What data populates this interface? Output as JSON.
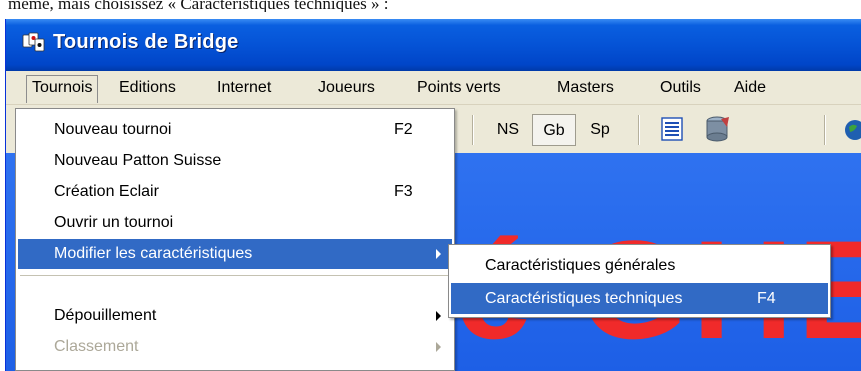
{
  "document": {
    "intro_text": "même, mais choisissez « Caractéristiques techniques » :"
  },
  "window": {
    "title": "Tournois de Bridge",
    "title_icon": "bridge-app-icon",
    "titlebar_color": "#0553d6"
  },
  "menubar": {
    "items": [
      {
        "label": "Tournois",
        "active": true
      },
      {
        "label": "Editions"
      },
      {
        "label": "Internet"
      },
      {
        "label": "Joueurs"
      },
      {
        "label": "Points verts"
      },
      {
        "label": "Masters"
      },
      {
        "label": "Outils"
      },
      {
        "label": "Aide"
      }
    ]
  },
  "toolbar": {
    "buttons": [
      {
        "label": "NS"
      },
      {
        "label": "Gb",
        "pressed": true
      },
      {
        "label": "Sp"
      }
    ],
    "icons": [
      "list-icon",
      "database-icon",
      "globe-icon"
    ]
  },
  "dropdown": {
    "items": [
      {
        "label": "Nouveau tournoi",
        "shortcut": "F2"
      },
      {
        "label": "Nouveau Patton Suisse",
        "shortcut": ""
      },
      {
        "label": "Création Eclair",
        "shortcut": "F3"
      },
      {
        "label": "Ouvrir un tournoi",
        "shortcut": ""
      },
      {
        "label": "Modifier les caractéristiques",
        "shortcut": "",
        "submenu": true,
        "selected": true
      },
      {
        "label": "Dépouillement",
        "shortcut": "",
        "submenu": true
      },
      {
        "label": "Classement",
        "shortcut": "",
        "submenu": true,
        "disabled": true
      }
    ]
  },
  "submenu": {
    "items": [
      {
        "label": "Caractéristiques générales",
        "shortcut": ""
      },
      {
        "label": "Caractéristiques techniques",
        "shortcut": "F4",
        "selected": true
      }
    ]
  },
  "colors": {
    "selection": "#316ac5",
    "menu_background": "#ece9d8",
    "content_background": "#2f72f0",
    "banner_text": "#f02a2a"
  }
}
